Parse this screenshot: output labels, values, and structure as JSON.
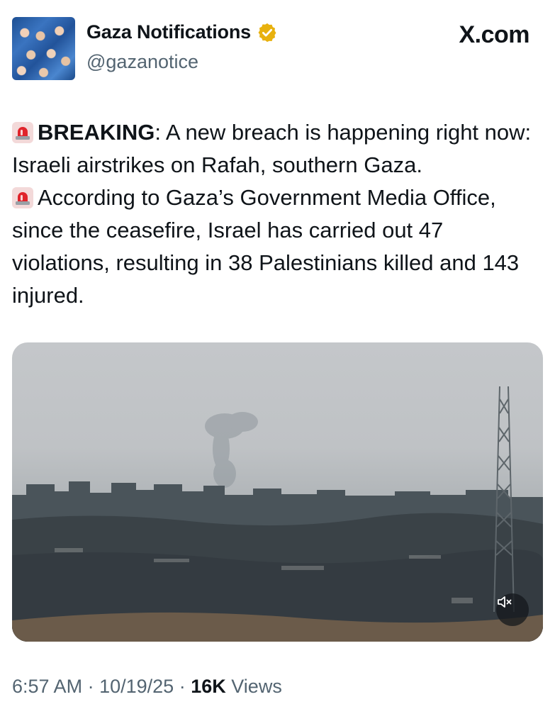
{
  "author": {
    "display_name": "Gaza Notifications",
    "handle": "@gazanotice",
    "verified_badge_icon": "verified-gold-badge-icon",
    "badge_color": "#e8b10e"
  },
  "source_label": "X.com",
  "tweet": {
    "paragraph1_lead": "BREAKING",
    "paragraph1_rest": ": A new breach is happening right now: Israeli airstrikes on Rafah, southern Gaza.",
    "paragraph2": "According to Gaza’s Government Media Office, since the ceasefire, Israel has carried out 47 violations, resulting in 38 Palestinians killed and 143 injured.",
    "emoji_icon": "police-siren-icon"
  },
  "media": {
    "type": "video",
    "mute_icon": "muted-speaker-icon"
  },
  "meta": {
    "time": "6:57 AM",
    "sep1": "·",
    "date": "10/19/25",
    "sep2": "·",
    "views_count": "16K",
    "views_label": "Views"
  }
}
